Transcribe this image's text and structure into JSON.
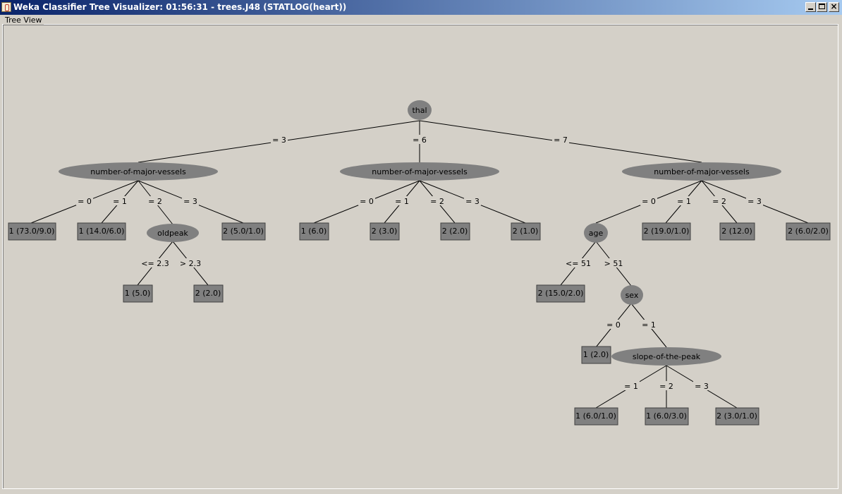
{
  "window": {
    "title": "Weka Classifier Tree Visualizer: 01:56:31 - trees.J48 (STATLOG(heart))"
  },
  "panel": {
    "label": "Tree View"
  },
  "tree": {
    "nodes": {
      "thal": "thal",
      "nmv1": "number-of-major-vessels",
      "nmv2": "number-of-major-vessels",
      "nmv3": "number-of-major-vessels",
      "oldpeak": "oldpeak",
      "age": "age",
      "sex": "sex",
      "slope": "slope-of-the-peak"
    },
    "leaves": {
      "l1": "1 (73.0/9.0)",
      "l2": "1 (14.0/6.0)",
      "l3": "2 (5.0/1.0)",
      "l4": "1 (5.0)",
      "l5": "2 (2.0)",
      "l6": "1 (6.0)",
      "l7": "2 (3.0)",
      "l8": "2 (2.0)",
      "l9": "2 (1.0)",
      "l10": "2 (19.0/1.0)",
      "l11": "2 (12.0)",
      "l12": "2 (6.0/2.0)",
      "l13": "2 (15.0/2.0)",
      "l14": "1 (2.0)",
      "l15": "1 (6.0/1.0)",
      "l16": "1 (6.0/3.0)",
      "l17": "2 (3.0/1.0)"
    },
    "edges": {
      "thal_3": "= 3",
      "thal_6": "= 6",
      "thal_7": "= 7",
      "a0": "= 0",
      "a1": "= 1",
      "a2": "= 2",
      "a3": "= 3",
      "b0": "= 0",
      "b1": "= 1",
      "b2": "= 2",
      "b3": "= 3",
      "c0": "= 0",
      "c1": "= 1",
      "c2": "= 2",
      "c3": "= 3",
      "op_le": "<= 2.3",
      "op_gt": "> 2.3",
      "age_le": "<= 51",
      "age_gt": "> 51",
      "sex0": "= 0",
      "sex1": "= 1",
      "sl1": "= 1",
      "sl2": "= 2",
      "sl3": "= 3"
    }
  }
}
